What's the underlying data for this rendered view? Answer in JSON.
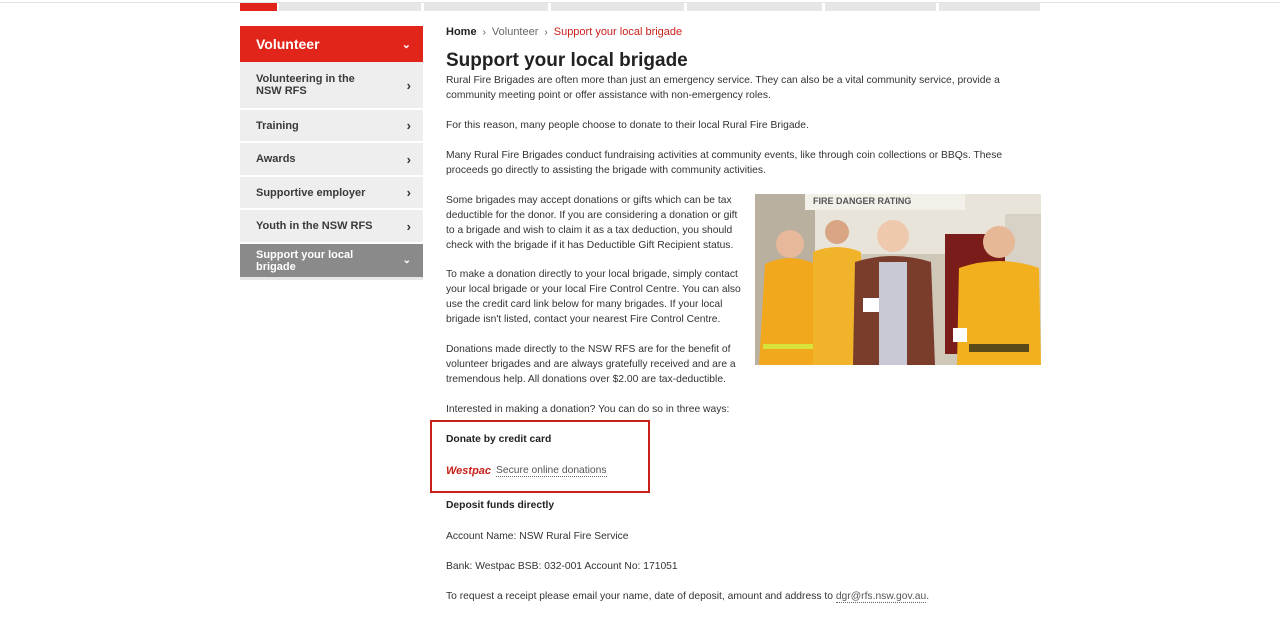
{
  "sidebar": {
    "header": "Volunteer",
    "items": [
      {
        "label": "Volunteering in the NSW RFS"
      },
      {
        "label": "Training"
      },
      {
        "label": "Awards"
      },
      {
        "label": "Supportive employer"
      },
      {
        "label": "Youth in the NSW RFS"
      },
      {
        "label": "Support your local brigade"
      }
    ]
  },
  "breadcrumb": {
    "home": "Home",
    "section": "Volunteer",
    "current": "Support your local brigade"
  },
  "main": {
    "title": "Support your local brigade",
    "p1": "Rural Fire Brigades are often more than just an emergency service. They can also be a vital community service, provide a community meeting point or offer assistance with non-emergency roles.",
    "p2": "For this reason, many people choose to donate to their local Rural Fire Brigade.",
    "p3": "Many Rural Fire Brigades conduct fundraising activities at community events, like through coin collections or BBQs. These proceeds go directly to assisting the brigade with community activities.",
    "p4": "Some brigades may accept donations or gifts which can be tax deductible for the donor. If you are considering a donation or gift to a brigade and wish to claim it as a tax deduction, you should check with the brigade if it has Deductible Gift Recipient status.",
    "p5": "To make a donation directly to your local brigade, simply contact your local brigade or your local Fire Control Centre. You can also use the credit card link below for many brigades. If your local brigade isn't listed, contact your nearest Fire Control Centre.",
    "p6": "Donations made directly to the NSW RFS are for the benefit of volunteer brigades and are always gratefully received and are a tremendous help. All donations over $2.00 are tax-deductible.",
    "p7": "Interested in making a donation? You can do so in three ways:",
    "photo_sign": "FIRE DANGER RATING",
    "donate_card_heading": "Donate by credit card",
    "westpac_logo": "Westpac",
    "secure_link": "Secure online donations",
    "deposit_heading": "Deposit funds directly",
    "account_name": "Account Name: NSW Rural Fire Service",
    "bank": "Bank: Westpac BSB: 032-001 Account No: 171051",
    "receipt_prefix": "To request a receipt please email your name, date of deposit, amount and address to ",
    "receipt_email": "dgr@rfs.nsw.gov.au",
    "receipt_suffix": "."
  },
  "colors": {
    "accent": "#e1251b",
    "active_item": "#8a8a8a",
    "sidebar_bg": "#eeeeee"
  }
}
